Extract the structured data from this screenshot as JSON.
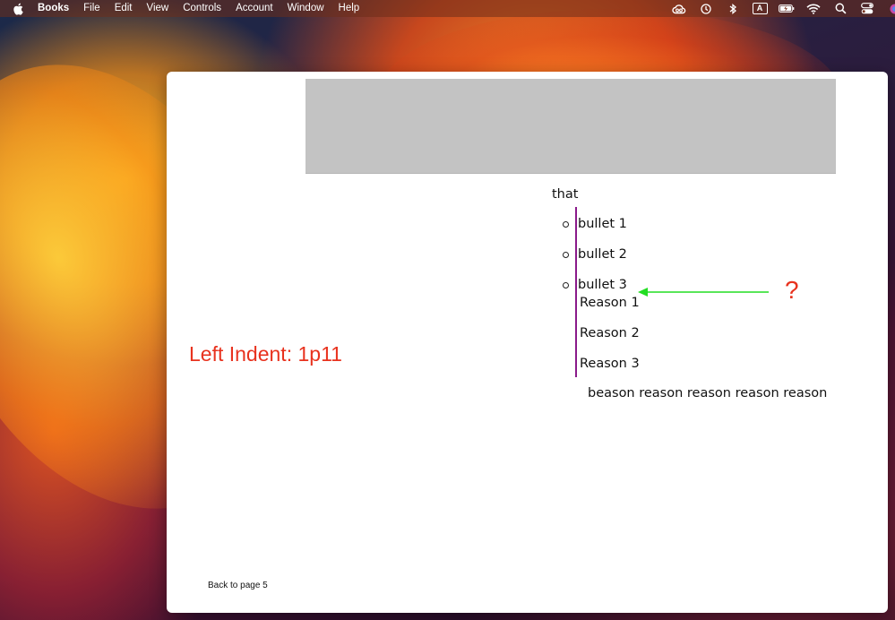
{
  "menubar": {
    "app_name": "Books",
    "items": [
      "File",
      "Edit",
      "View",
      "Controls",
      "Account",
      "Window",
      "Help"
    ],
    "input_source": "A",
    "status_icons": [
      "creative-cloud-icon",
      "time-machine-icon",
      "bluetooth-icon",
      "input-source-icon",
      "battery-icon",
      "wifi-icon",
      "spotlight-icon",
      "control-center-icon",
      "siri-icon"
    ]
  },
  "page": {
    "intro": "that",
    "bullets": [
      "bullet 1",
      "bullet 2",
      "bullet 3"
    ],
    "reasons": [
      "Reason 1",
      "Reason 2",
      "Reason 3"
    ],
    "trailing": "beason reason reason reason reason",
    "back_link": "Back to page 5"
  },
  "annotations": {
    "indent_label": "Left Indent: 1p11",
    "question_mark": "?",
    "annotation_color": "#e8321e",
    "arrow_color": "#22dd22",
    "indent_rule_color": "#8a1a8a"
  }
}
